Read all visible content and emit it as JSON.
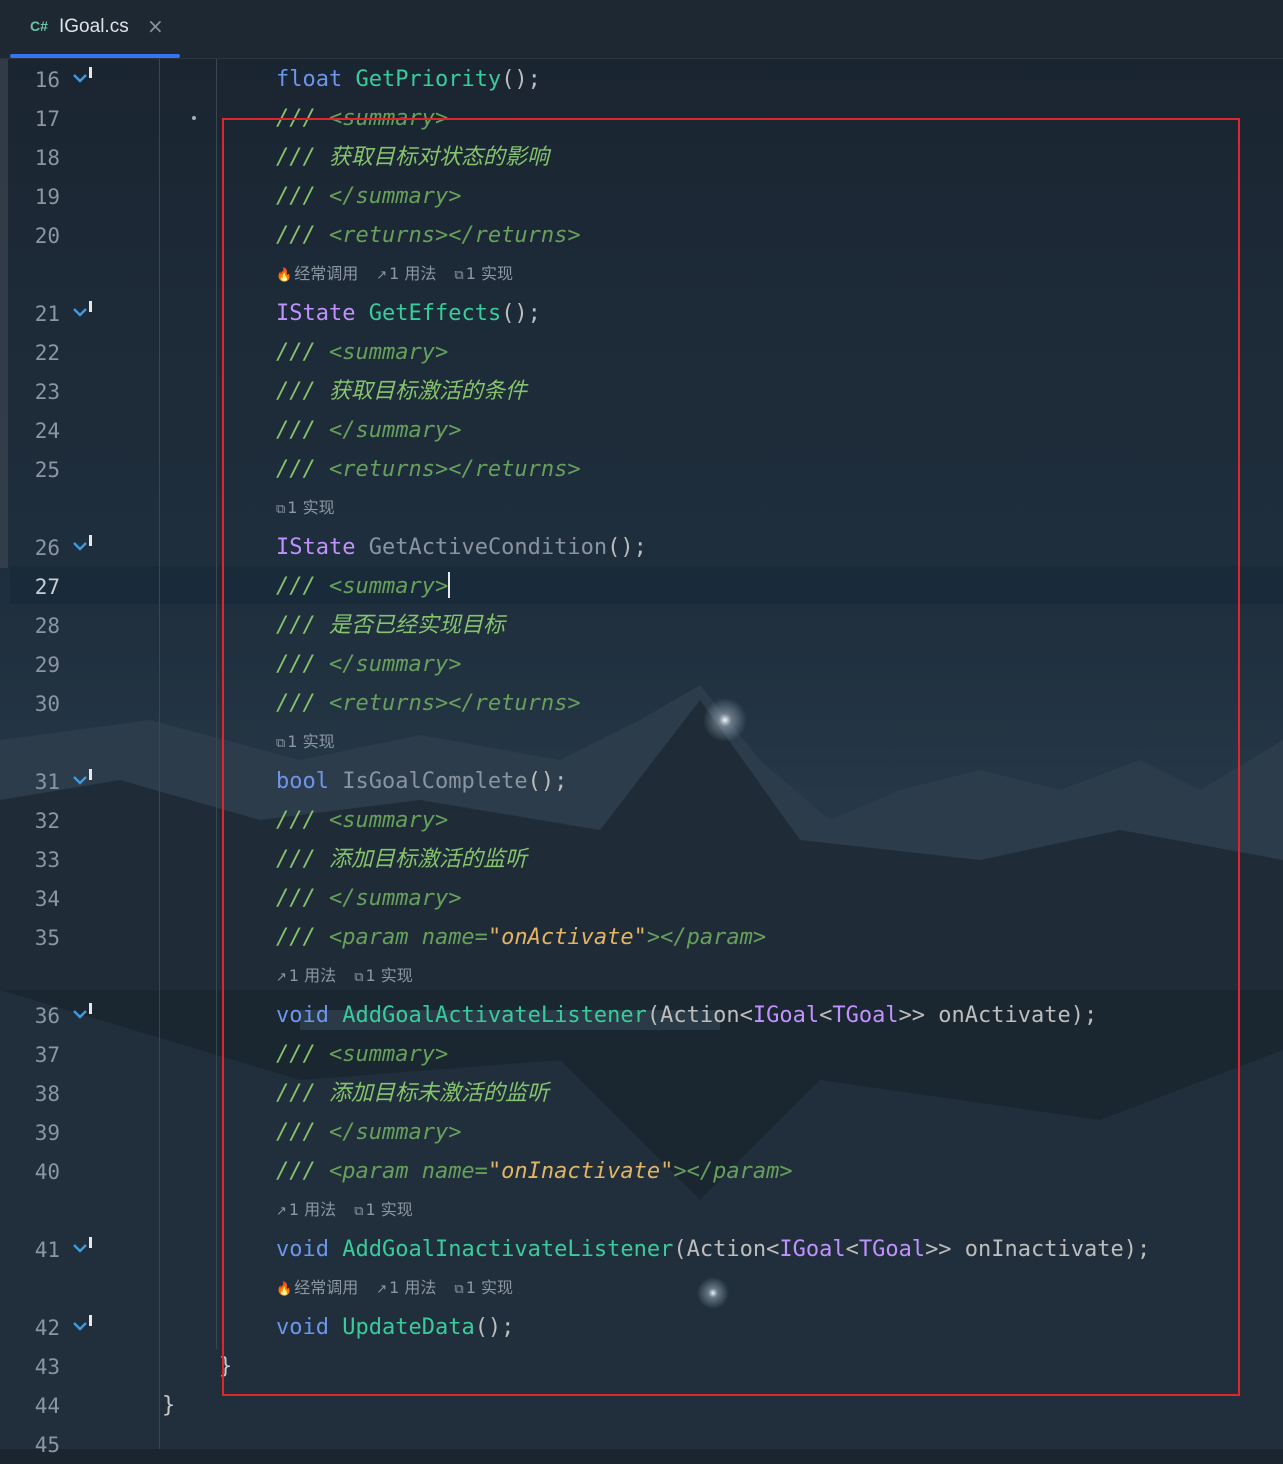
{
  "tab": {
    "lang": "C#",
    "filename": "IGoal.cs",
    "close": "×"
  },
  "lines": [
    {
      "n": "16",
      "gutter": true,
      "tokens": [
        [
          "kw",
          "float"
        ],
        [
          "fg",
          " "
        ],
        [
          "fn",
          "GetPriority"
        ],
        [
          "fg",
          "();"
        ]
      ]
    },
    {
      "n": "17",
      "tokens": [
        [
          "cm",
          "/// "
        ],
        [
          "tag",
          "<summary>"
        ]
      ]
    },
    {
      "n": "18",
      "tokens": [
        [
          "cm",
          "/// 获取目标对状态的影响"
        ]
      ]
    },
    {
      "n": "19",
      "tokens": [
        [
          "cm",
          "/// "
        ],
        [
          "tag",
          "</summary>"
        ]
      ]
    },
    {
      "n": "20",
      "tokens": [
        [
          "cm",
          "/// "
        ],
        [
          "tag",
          "<returns></returns>"
        ]
      ]
    },
    {
      "hint": [
        [
          "🔥",
          "经常调用"
        ],
        [
          "↗",
          "1 用法"
        ],
        [
          "⧉",
          "1 实现"
        ]
      ]
    },
    {
      "n": "21",
      "gutter": true,
      "tokens": [
        [
          "typ",
          "IState"
        ],
        [
          "fg",
          " "
        ],
        [
          "fn",
          "GetEffects"
        ],
        [
          "fg",
          "();"
        ]
      ]
    },
    {
      "n": "22",
      "tokens": [
        [
          "cm",
          "/// "
        ],
        [
          "tag",
          "<summary>"
        ]
      ]
    },
    {
      "n": "23",
      "tokens": [
        [
          "cm",
          "/// 获取目标激活的条件"
        ]
      ]
    },
    {
      "n": "24",
      "tokens": [
        [
          "cm",
          "/// "
        ],
        [
          "tag",
          "</summary>"
        ]
      ]
    },
    {
      "n": "25",
      "tokens": [
        [
          "cm",
          "/// "
        ],
        [
          "tag",
          "<returns></returns>"
        ]
      ]
    },
    {
      "hint": [
        [
          "⧉",
          "1 实现"
        ]
      ]
    },
    {
      "n": "26",
      "gutter": true,
      "tokens": [
        [
          "typ",
          "IState"
        ],
        [
          "fg",
          " "
        ],
        [
          "dim",
          "GetActiveCondition"
        ],
        [
          "fg",
          "();"
        ]
      ]
    },
    {
      "n": "27",
      "current": true,
      "tokens": [
        [
          "cm",
          "/// "
        ],
        [
          "tag",
          "<summary>"
        ],
        [
          "caret",
          ""
        ]
      ]
    },
    {
      "n": "28",
      "tokens": [
        [
          "cm",
          "/// 是否已经实现目标"
        ]
      ]
    },
    {
      "n": "29",
      "tokens": [
        [
          "cm",
          "/// "
        ],
        [
          "tag",
          "</summary>"
        ]
      ]
    },
    {
      "n": "30",
      "tokens": [
        [
          "cm",
          "/// "
        ],
        [
          "tag",
          "<returns></returns>"
        ]
      ]
    },
    {
      "hint": [
        [
          "⧉",
          "1 实现"
        ]
      ]
    },
    {
      "n": "31",
      "gutter": true,
      "tokens": [
        [
          "kw",
          "bool"
        ],
        [
          "fg",
          " "
        ],
        [
          "dim",
          "IsGoalComplete"
        ],
        [
          "fg",
          "();"
        ]
      ]
    },
    {
      "n": "32",
      "tokens": [
        [
          "cm",
          "/// "
        ],
        [
          "tag",
          "<summary>"
        ]
      ]
    },
    {
      "n": "33",
      "tokens": [
        [
          "cm",
          "/// 添加目标激活的监听"
        ]
      ]
    },
    {
      "n": "34",
      "tokens": [
        [
          "cm",
          "/// "
        ],
        [
          "tag",
          "</summary>"
        ]
      ]
    },
    {
      "n": "35",
      "tokens": [
        [
          "cm",
          "/// "
        ],
        [
          "tag",
          "<param name="
        ],
        [
          "str",
          "\"onActivate\""
        ],
        [
          "tag",
          "></param>"
        ]
      ]
    },
    {
      "hint": [
        [
          "↗",
          "1 用法"
        ],
        [
          "⧉",
          "1 实现"
        ]
      ]
    },
    {
      "n": "36",
      "gutter": true,
      "tokens": [
        [
          "kw",
          "void"
        ],
        [
          "fg",
          " "
        ],
        [
          "fn",
          "AddGoalActivateListener"
        ],
        [
          "fg",
          "(Action<"
        ],
        [
          "typ",
          "IGoal"
        ],
        [
          "fg",
          "<"
        ],
        [
          "typ",
          "TGoal"
        ],
        [
          "fg",
          ">> onActivate);"
        ]
      ]
    },
    {
      "n": "37",
      "tokens": [
        [
          "cm",
          "/// "
        ],
        [
          "tag",
          "<summary>"
        ]
      ]
    },
    {
      "n": "38",
      "tokens": [
        [
          "cm",
          "/// 添加目标未激活的监听"
        ]
      ]
    },
    {
      "n": "39",
      "tokens": [
        [
          "cm",
          "/// "
        ],
        [
          "tag",
          "</summary>"
        ]
      ]
    },
    {
      "n": "40",
      "tokens": [
        [
          "cm",
          "/// "
        ],
        [
          "tag",
          "<param name="
        ],
        [
          "str",
          "\"onInactivate\""
        ],
        [
          "tag",
          "></param>"
        ]
      ]
    },
    {
      "hint": [
        [
          "↗",
          "1 用法"
        ],
        [
          "⧉",
          "1 实现"
        ]
      ]
    },
    {
      "n": "41",
      "gutter": true,
      "tokens": [
        [
          "kw",
          "void"
        ],
        [
          "fg",
          " "
        ],
        [
          "fn",
          "AddGoalInactivateListener"
        ],
        [
          "fg",
          "(Action<"
        ],
        [
          "typ",
          "IGoal"
        ],
        [
          "fg",
          "<"
        ],
        [
          "typ",
          "TGoal"
        ],
        [
          "fg",
          ">> onInactivate);"
        ]
      ]
    },
    {
      "hint": [
        [
          "🔥",
          "经常调用"
        ],
        [
          "↗",
          "1 用法"
        ],
        [
          "⧉",
          "1 实现"
        ]
      ]
    },
    {
      "n": "42",
      "gutter": true,
      "tokens": [
        [
          "kw",
          "void"
        ],
        [
          "fg",
          " "
        ],
        [
          "fn",
          "UpdateData"
        ],
        [
          "fg",
          "();"
        ]
      ]
    },
    {
      "n": "43",
      "brace": "}"
    },
    {
      "n": "44",
      "brace": "}"
    },
    {
      "n": "45"
    }
  ],
  "gutter_icon": "implement-down-arrow-icon"
}
